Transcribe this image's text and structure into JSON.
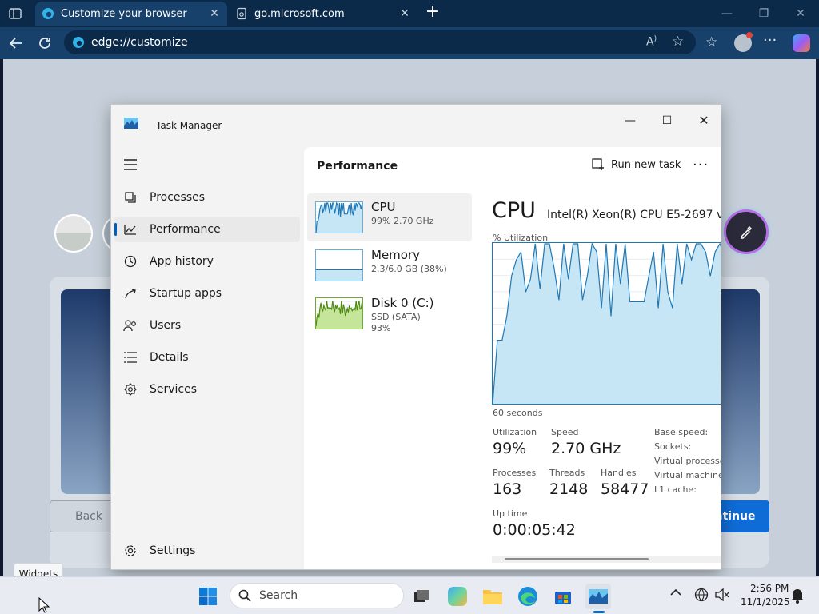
{
  "browser": {
    "tabs": [
      {
        "title": "Customize your browser",
        "active": true
      },
      {
        "title": "go.microsoft.com",
        "active": false
      }
    ],
    "address": "edge://customize"
  },
  "page": {
    "back_label": "Back",
    "continue_label": "ontinue"
  },
  "task_manager": {
    "title": "Task Manager",
    "nav": [
      {
        "label": "Processes",
        "icon": "processes-icon"
      },
      {
        "label": "Performance",
        "icon": "performance-icon",
        "selected": true
      },
      {
        "label": "App history",
        "icon": "history-icon"
      },
      {
        "label": "Startup apps",
        "icon": "startup-icon"
      },
      {
        "label": "Users",
        "icon": "users-icon"
      },
      {
        "label": "Details",
        "icon": "details-icon"
      },
      {
        "label": "Services",
        "icon": "services-icon"
      }
    ],
    "settings_label": "Settings",
    "section_title": "Performance",
    "run_task_label": "Run new task",
    "devices": [
      {
        "name": "CPU",
        "sub1": "99%  2.70 GHz",
        "sub2": ""
      },
      {
        "name": "Memory",
        "sub1": "2.3/6.0 GB (38%)",
        "sub2": ""
      },
      {
        "name": "Disk 0 (C:)",
        "sub1": "SSD (SATA)",
        "sub2": "93%"
      }
    ],
    "cpu": {
      "heading": "CPU",
      "model": "Intel(R) Xeon(R) CPU E5-2697 v",
      "graph_label": "% Utilization",
      "time_label": "60 seconds",
      "utilization_percent_series": [
        0,
        40,
        40,
        55,
        80,
        90,
        95,
        70,
        78,
        100,
        72,
        100,
        100,
        85,
        65,
        100,
        78,
        100,
        100,
        65,
        80,
        100,
        95,
        60,
        100,
        55,
        100,
        75,
        100,
        64,
        64,
        64,
        64,
        80,
        95,
        60,
        100,
        70,
        60,
        100,
        75,
        100,
        90,
        100,
        100,
        95,
        80,
        95,
        100,
        93
      ],
      "stats": {
        "utilization": {
          "label": "Utilization",
          "value": "99%"
        },
        "speed": {
          "label": "Speed",
          "value": "2.70 GHz"
        },
        "processes": {
          "label": "Processes",
          "value": "163"
        },
        "threads": {
          "label": "Threads",
          "value": "2148"
        },
        "handles": {
          "label": "Handles",
          "value": "58477"
        },
        "uptime": {
          "label": "Up time",
          "value": "0:00:05:42"
        }
      },
      "right_labels": [
        "Base speed:",
        "Sockets:",
        "Virtual processo",
        "Virtual machine",
        "L1 cache:"
      ]
    }
  },
  "taskbar": {
    "tooltip": "Widgets",
    "search_placeholder": "Search",
    "time": "2:56 PM",
    "date": "11/1/2025"
  },
  "colors": {
    "accent": "#005fb8",
    "graph_fill": "#c6e6f6",
    "graph_line": "#1f78b4",
    "disk_fill": "#c5e59a",
    "disk_line": "#4f8a10"
  }
}
